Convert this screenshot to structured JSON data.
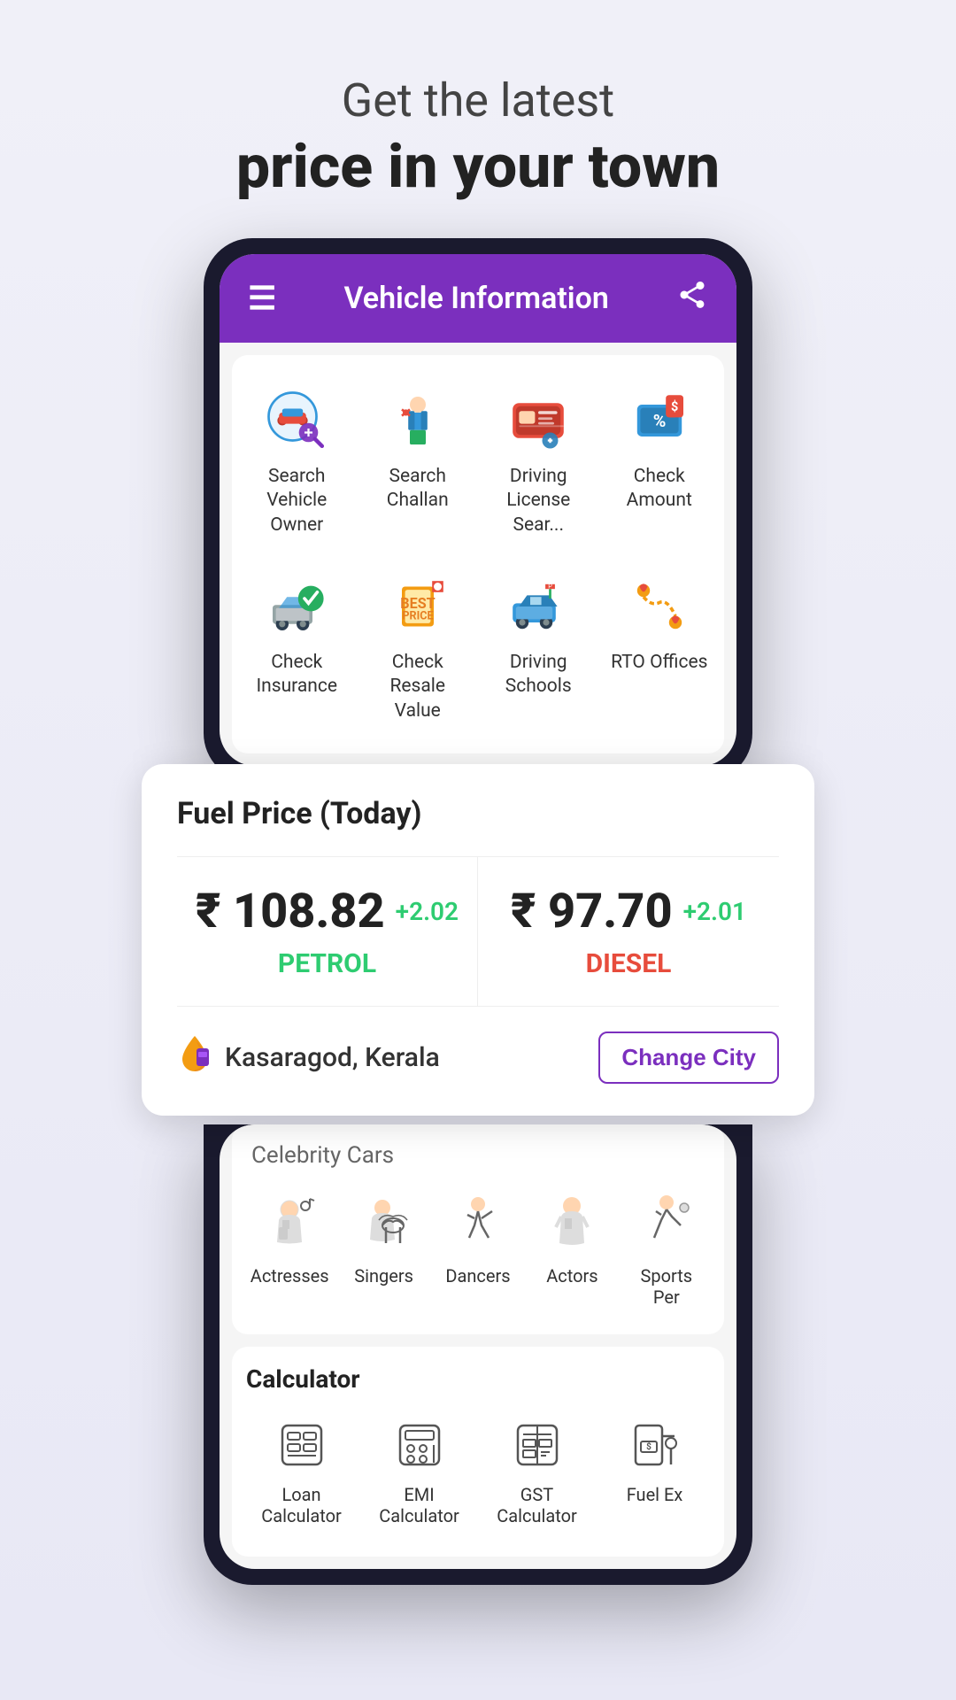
{
  "header": {
    "subtitle": "Get the latest",
    "title": "price in your town"
  },
  "appBar": {
    "title": "Vehicle Information"
  },
  "vehicleGrid": {
    "items": [
      {
        "id": "search-vehicle-owner",
        "label": "Search Vehicle\nOwner",
        "icon": "🔍🚗"
      },
      {
        "id": "search-challan",
        "label": "Search\nChallan",
        "icon": "👮"
      },
      {
        "id": "driving-license",
        "label": "Driving\nLicense Sear...",
        "icon": "🪪"
      },
      {
        "id": "check-amount",
        "label": "Check\nAmount",
        "icon": "💰"
      },
      {
        "id": "check-insurance",
        "label": "Check\nInsurance",
        "icon": "🛡️"
      },
      {
        "id": "check-resale",
        "label": "Check Resale\nValue",
        "icon": "🏷️"
      },
      {
        "id": "driving-schools",
        "label": "Driving\nSchools",
        "icon": "🚗"
      },
      {
        "id": "rto-offices",
        "label": "RTO Offices",
        "icon": "📍"
      }
    ]
  },
  "fuelCard": {
    "title": "Fuel Price (Today)",
    "petrol": {
      "price": "₹ 108.82",
      "change": "+2.02",
      "label": "PETROL"
    },
    "diesel": {
      "price": "₹ 97.70",
      "change": "+2.01",
      "label": "DIESEL"
    },
    "city": "Kasaragod, Kerala",
    "changeCityBtn": "Change City"
  },
  "celebrity": {
    "sectionLabel": "Celebrity Cars",
    "items": [
      {
        "id": "actresses",
        "label": "Actresses",
        "icon": "👩‍🎤"
      },
      {
        "id": "singers",
        "label": "Singers",
        "icon": "🎸"
      },
      {
        "id": "dancers",
        "label": "Dancers",
        "icon": "💃"
      },
      {
        "id": "actors",
        "label": "Actors",
        "icon": "🎭"
      },
      {
        "id": "sports-per",
        "label": "Sports Per",
        "icon": "⛷️"
      }
    ]
  },
  "calculator": {
    "title": "Calculator",
    "items": [
      {
        "id": "loan-calc",
        "label": "Loan Calculator",
        "icon": "🧮"
      },
      {
        "id": "emi-calc",
        "label": "EMI Calculator",
        "icon": "📊"
      },
      {
        "id": "gst-calc",
        "label": "GST Calculator",
        "icon": "🧾"
      },
      {
        "id": "fuel-ex",
        "label": "Fuel Ex",
        "icon": "⛽"
      }
    ]
  }
}
